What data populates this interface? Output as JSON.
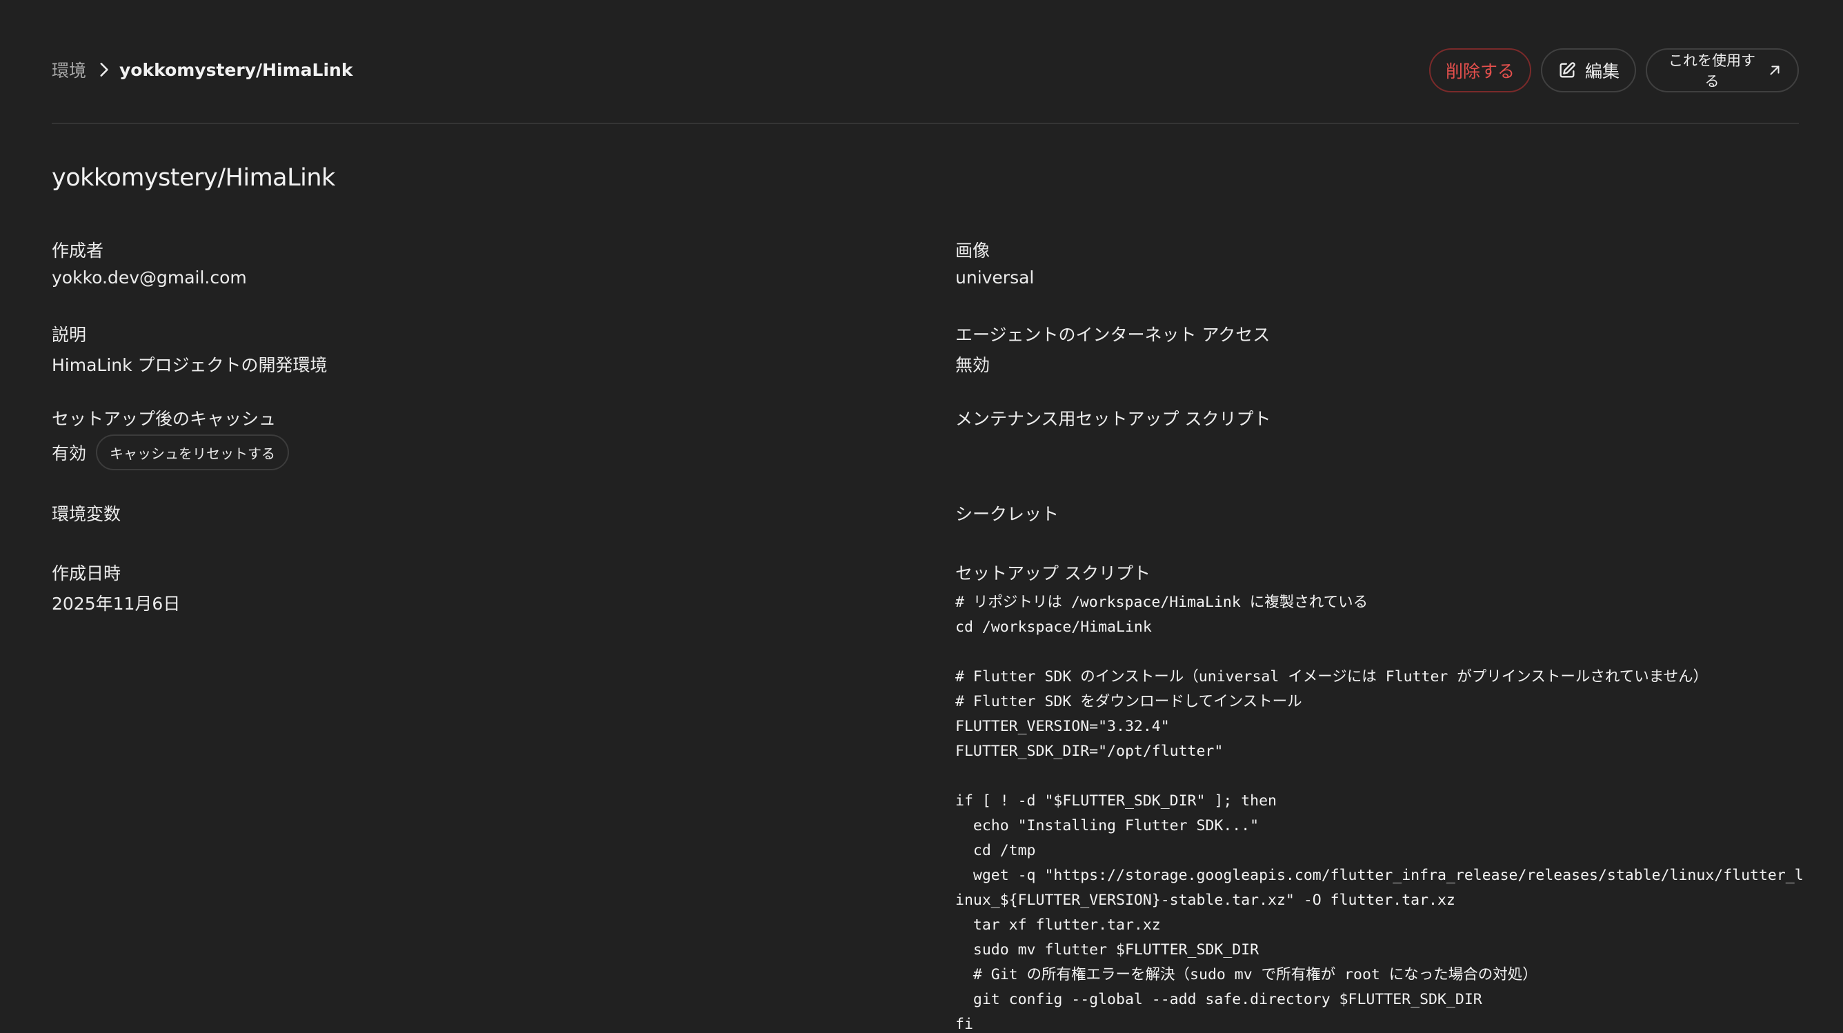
{
  "breadcrumb": {
    "root": "環境",
    "current": "yokkomystery/HimaLink"
  },
  "actions": {
    "delete_label": "削除する",
    "edit_label": "編集",
    "use_label": "これを使用する"
  },
  "title": "yokkomystery/HimaLink",
  "fields": {
    "creator_label": "作成者",
    "creator_value": "yokko.dev@gmail.com",
    "description_label": "説明",
    "description_value": "HimaLink プロジェクトの開発環境",
    "cache_label": "セットアップ後のキャッシュ",
    "cache_value": "有効",
    "cache_reset_label": "キャッシュをリセットする",
    "env_vars_label": "環境変数",
    "created_label": "作成日時",
    "created_value": "2025年11月6日",
    "image_label": "画像",
    "image_value": "universal",
    "internet_label": "エージェントのインターネット アクセス",
    "internet_value": "無効",
    "maintenance_label": "メンテナンス用セットアップ スクリプト",
    "secrets_label": "シークレット",
    "setup_label": "セットアップ スクリプト"
  },
  "setup_script": "# リポジトリは /workspace/HimaLink に複製されている\ncd /workspace/HimaLink\n\n# Flutter SDK のインストール（universal イメージには Flutter がプリインストールされていません）\n# Flutter SDK をダウンロードしてインストール\nFLUTTER_VERSION=\"3.32.4\"\nFLUTTER_SDK_DIR=\"/opt/flutter\"\n\nif [ ! -d \"$FLUTTER_SDK_DIR\" ]; then\n  echo \"Installing Flutter SDK...\"\n  cd /tmp\n  wget -q \"https://storage.googleapis.com/flutter_infra_release/releases/stable/linux/flutter_linux_${FLUTTER_VERSION}-stable.tar.xz\" -O flutter.tar.xz\n  tar xf flutter.tar.xz\n  sudo mv flutter $FLUTTER_SDK_DIR\n  # Git の所有権エラーを解決（sudo mv で所有権が root になった場合の対処）\n  git config --global --add safe.directory $FLUTTER_SDK_DIR\nfi",
  "icons": {
    "breadcrumb_separator": "chevron-right-icon",
    "edit": "pencil-square-icon",
    "external": "arrow-up-right-icon"
  },
  "colors": {
    "background": "#212121",
    "danger": "#e5504d"
  }
}
